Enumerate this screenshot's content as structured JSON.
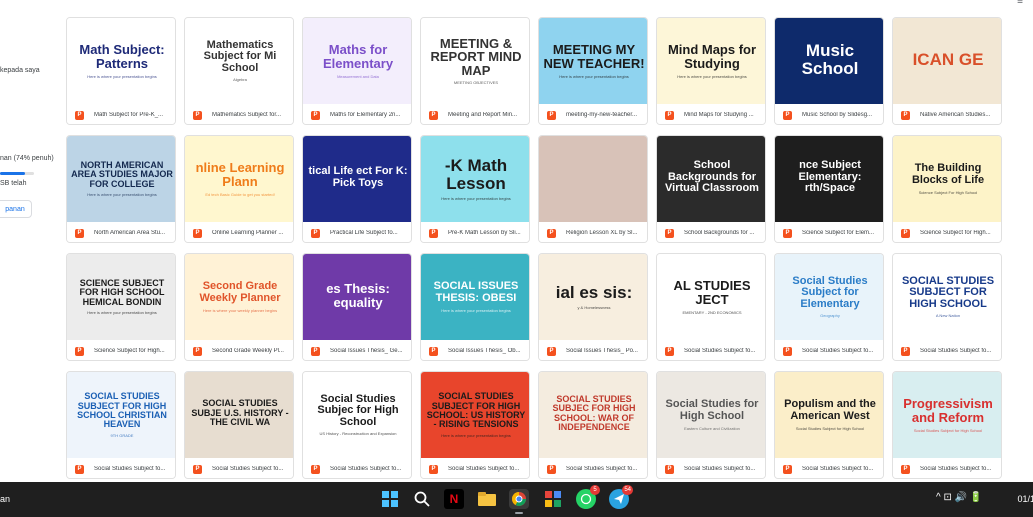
{
  "topbar": {
    "crumb": "",
    "right_icons": "≡"
  },
  "sidebar": {
    "line1": "kepada saya",
    "line2": "nan (74% penuh)",
    "line3": "SB telah",
    "button": "panan",
    "storage_fraction": 0.74
  },
  "files": [
    {
      "name": "Math Subject for Pre-K_...",
      "title": "Math Subject: Patterns",
      "sub": "Here is where your presentation begins",
      "bg": "#ffffff",
      "fg": "#1e2a78"
    },
    {
      "name": "Mathematics Subject for...",
      "title": "Mathematics Subject for Mi School",
      "sub": "Algebra",
      "bg": "#ffffff",
      "fg": "#333333"
    },
    {
      "name": "Maths for Elementary 2n...",
      "title": "Maths for Elementary",
      "sub": "Measurement and Data",
      "bg": "#f3eefc",
      "fg": "#7b4fc9"
    },
    {
      "name": "Meeting and Report Min...",
      "title": "MEETING & REPORT MIND MAP",
      "sub": "MEETING OBJECTIVES",
      "bg": "#ffffff",
      "fg": "#333333"
    },
    {
      "name": "meeting-my-new-teacher...",
      "title": "MEETING MY NEW TEACHER!",
      "sub": "Here is where your presentation begins",
      "bg": "#8fd3ef",
      "fg": "#1b1b1b"
    },
    {
      "name": "Mind Maps for Studying ...",
      "title": "Mind Maps for Studying",
      "sub": "Here is where your presentation begins",
      "bg": "#fdf6d8",
      "fg": "#1b1b1b"
    },
    {
      "name": "Music School by Slidesg...",
      "title": "Music School",
      "sub": "",
      "bg": "#0e2a6b",
      "fg": "#ffffff"
    },
    {
      "name": "Native American Studies...",
      "title": "ICAN GE",
      "sub": "",
      "bg": "#f2e7d4",
      "fg": "#d9502a"
    },
    {
      "name": "North American Area Stu...",
      "title": "NORTH AMERICAN AREA STUDIES MAJOR FOR COLLEGE",
      "sub": "Here is where your presentation begins",
      "bg": "#bcd4e6",
      "fg": "#14294f"
    },
    {
      "name": "Online Learning Planner ...",
      "title": "nline Learning Plann",
      "sub": "Ed tech Basic Guide to get you started!",
      "bg": "#fff7cf",
      "fg": "#ef7c1a"
    },
    {
      "name": "Practical Life Subject fo...",
      "title": "tical Life ect For K: Pick Toys",
      "sub": "",
      "bg": "#1f2b8a",
      "fg": "#ffffff"
    },
    {
      "name": "Pre-K Math Lesson by Sli...",
      "title": "-K Math Lesson",
      "sub": "Here is where your presentation begins",
      "bg": "#8ee0ec",
      "fg": "#1b1b1b"
    },
    {
      "name": "Religion Lesson XL by Sl...",
      "title": "",
      "sub": "",
      "bg": "#d8c2b8",
      "fg": "#333333"
    },
    {
      "name": "School Backgrounds for ...",
      "title": "School Backgrounds for Virtual Classroom",
      "sub": "",
      "bg": "#2b2b2b",
      "fg": "#ffffff"
    },
    {
      "name": "Science Subject for Elem...",
      "title": "nce Subject Elementary: rth/Space",
      "sub": "",
      "bg": "#1e1e1e",
      "fg": "#ffffff"
    },
    {
      "name": "Science Subject for High...",
      "title": "The Building Blocks of Life",
      "sub": "Science Subject For High School",
      "bg": "#fdf3c8",
      "fg": "#1b1b1b"
    },
    {
      "name": "Science Subject for High...",
      "title": "SCIENCE SUBJECT FOR HIGH SCHOOL HEMICAL BONDIN",
      "sub": "Here is where your presentation begins",
      "bg": "#ececec",
      "fg": "#1b1b1b"
    },
    {
      "name": "Second Grade Weekly Pl...",
      "title": "Second Grade Weekly Planner",
      "sub": "Here is where your weekly planner begins",
      "bg": "#fff2d6",
      "fg": "#e0542a"
    },
    {
      "name": "Social Issues Thesis_ Ge...",
      "title": "es Thesis: equality",
      "sub": "",
      "bg": "#6f3aa8",
      "fg": "#ffffff"
    },
    {
      "name": "Social Issues Thesis_ Ob...",
      "title": "SOCIAL ISSUES THESIS: OBESI",
      "sub": "Here is where your presentation begins",
      "bg": "#3bb3c3",
      "fg": "#ffffff"
    },
    {
      "name": "Social Issues Thesis_ Po...",
      "title": "ial es sis:",
      "sub": "y & Homelessness",
      "bg": "#f7eedf",
      "fg": "#1b1b1b"
    },
    {
      "name": "Social Studies Subject fo...",
      "title": "AL STUDIES JECT",
      "sub": "EMENTARY - 2ND ECONOMICS",
      "bg": "#ffffff",
      "fg": "#1b1b1b"
    },
    {
      "name": "Social Studies Subject fo...",
      "title": "Social Studies Subject for Elementary",
      "sub": "Geography",
      "bg": "#e8f3fa",
      "fg": "#2a7cc7"
    },
    {
      "name": "Social Studies Subject fo...",
      "title": "SOCIAL STUDIES SUBJECT FOR HIGH SCHOOL",
      "sub": "A New Nation",
      "bg": "#ffffff",
      "fg": "#173a8a"
    },
    {
      "name": "Social Studies Subject fo...",
      "title": "SOCIAL STUDIES SUBJECT FOR HIGH SCHOOL CHRISTIAN HEAVEN",
      "sub": "9TH GRADE",
      "bg": "#eef4fb",
      "fg": "#1a5fb4"
    },
    {
      "name": "Social Studies Subject fo...",
      "title": "SOCIAL STUDIES SUBJE U.S. HISTORY - THE CIVIL WA",
      "sub": "",
      "bg": "#e7ddd0",
      "fg": "#1b1b1b"
    },
    {
      "name": "Social Studies Subject fo...",
      "title": "Social Studies Subjec for High School",
      "sub": "US History - Reconstruction and Expansion",
      "bg": "#ffffff",
      "fg": "#1b1b1b"
    },
    {
      "name": "Social Studies Subject fo...",
      "title": "SOCIAL STUDIES SUBJECT FOR HIGH SCHOOL: US HISTORY - RISING TENSIONS",
      "sub": "Here is where your presentation begins",
      "bg": "#e8452c",
      "fg": "#1b1b1b"
    },
    {
      "name": "Social Studies Subject fo...",
      "title": "SOCIAL STUDIES SUBJEC FOR HIGH SCHOOL: WAR OF INDEPENDENCE",
      "sub": "",
      "bg": "#f4ecdf",
      "fg": "#c0392b"
    },
    {
      "name": "Social Studies Subject fo...",
      "title": "Social Studies for High School",
      "sub": "Eastern Culture and Civilization",
      "bg": "#ece8e2",
      "fg": "#555555"
    },
    {
      "name": "Social Studies Subject fo...",
      "title": "Populism and the American West",
      "sub": "Social Studies Subject for High School",
      "bg": "#fbeec9",
      "fg": "#1b1b1b"
    },
    {
      "name": "Social Studies Subject fo...",
      "title": "Progressivism and Reform",
      "sub": "Social Studies Subject for High School",
      "bg": "#d8eef0",
      "fg": "#d8302f"
    }
  ],
  "taskbar": {
    "left_text": "an",
    "whatsapp_badge": "5",
    "telegram_badge": "54",
    "clock": "01/1",
    "tray": "^  ⊡  🔊  🔋"
  },
  "colors": {
    "ppt": "#f4511e",
    "accent": "#1a73e8",
    "taskbar": "#1f1f1f"
  }
}
